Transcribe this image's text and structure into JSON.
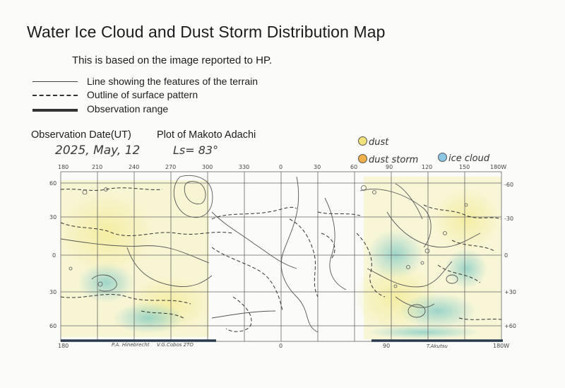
{
  "title": "Water Ice Cloud and Dust Storm Distribution Map",
  "subtitle": "This is based on the image reported to HP.",
  "legend": [
    {
      "style": "solid",
      "label": "Line showing the features of the terrain"
    },
    {
      "style": "dashed",
      "label": "Outline of surface pattern"
    },
    {
      "style": "thick",
      "label": "Observation range"
    }
  ],
  "observation_label": "Observation Date(UT)",
  "observation_date": "2025, May, 12",
  "plot_label": "Plot of Makoto Adachi",
  "ls_value": "Ls= 83°",
  "key": [
    {
      "label": "dust",
      "color": "#f3e27a"
    },
    {
      "label": "dust storm",
      "color": "#f2b04a"
    },
    {
      "label": "ice cloud",
      "color": "#8ec6e6"
    }
  ],
  "map": {
    "top_ticks": [
      "180",
      "210",
      "240",
      "270",
      "300",
      "330",
      "0",
      "30",
      "60",
      "90",
      "120",
      "150",
      "180W"
    ],
    "bottom_ticks": [
      "180",
      "0",
      "90",
      "180W"
    ],
    "left_lat": [
      "60",
      "30",
      "0",
      "30",
      "60"
    ],
    "right_lat": [
      "-60",
      "-30",
      "0",
      "+30",
      "+60"
    ],
    "credits": [
      "P.A. Hinebrecht",
      "V.G.Cobos 2TO",
      "T.Akutsu"
    ]
  }
}
